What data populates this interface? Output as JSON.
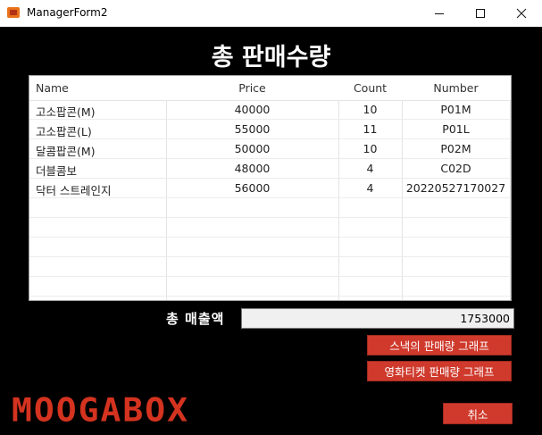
{
  "window": {
    "title": "ManagerForm2",
    "icon": "app-icon",
    "controls": [
      "minimize-icon",
      "maximize-icon",
      "close-icon"
    ]
  },
  "form_title": "총 판매수량",
  "grid": {
    "columns": [
      "Name",
      "Price",
      "Count",
      "Number"
    ],
    "rows": [
      {
        "name": "고소팝콘(M)",
        "price": "40000",
        "count": "10",
        "number": "P01M"
      },
      {
        "name": "고소팝콘(L)",
        "price": "55000",
        "count": "11",
        "number": "P01L"
      },
      {
        "name": "달콤팝콘(M)",
        "price": "50000",
        "count": "10",
        "number": "P02M"
      },
      {
        "name": "더블콤보",
        "price": "48000",
        "count": "4",
        "number": "C02D"
      },
      {
        "name": "닥터 스트레인지",
        "price": "56000",
        "count": "4",
        "number": "20220527170027"
      }
    ]
  },
  "total": {
    "label": "총 매출액",
    "value": "1753000"
  },
  "buttons": {
    "snack_graph": "스낵의 판매량 그래프",
    "ticket_graph": "영화티켓 판매량 그래프",
    "cancel": "취소"
  },
  "logo_text": "MOOGABOX",
  "colors": {
    "background": "#000000",
    "accent_red": "#cf3a2c",
    "logo_red": "#d4331f"
  }
}
